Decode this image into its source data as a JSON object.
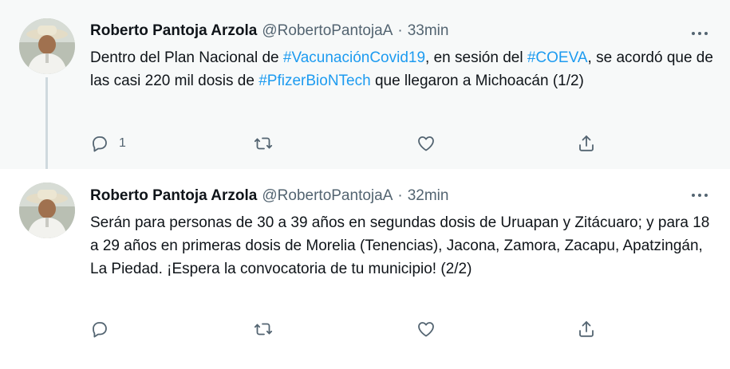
{
  "tweets": [
    {
      "name": "Roberto Pantoja Arzola",
      "handle": "@RobertoPantojaA",
      "dot": "·",
      "time": "33min",
      "text": [
        {
          "t": "Dentro del Plan Nacional de ",
          "tag": false
        },
        {
          "t": "#VacunaciónCovid19",
          "tag": true
        },
        {
          "t": ", en sesión del ",
          "tag": false
        },
        {
          "t": "#COEVA",
          "tag": true
        },
        {
          "t": ", se acordó que de las casi 220 mil dosis de ",
          "tag": false
        },
        {
          "t": "#PfizerBioNTech",
          "tag": true
        },
        {
          "t": " que llegaron a Michoacán (1/2)",
          "tag": false
        }
      ],
      "reply_count": "1"
    },
    {
      "name": "Roberto Pantoja Arzola",
      "handle": "@RobertoPantojaA",
      "dot": "·",
      "time": "32min",
      "text_plain": "Serán para personas de 30 a 39 años en segundas dosis de Uruapan y Zitácuaro; y para 18 a 29 años en primeras dosis de Morelia (Tenencias), Jacona, Zamora, Zacapu, Apatzingán, La Piedad. ¡Espera la convocatoria de tu municipio! (2/2)"
    }
  ],
  "icons": {
    "reply": "reply-icon",
    "retweet": "retweet-icon",
    "like": "like-icon",
    "share": "share-icon",
    "more": "more-icon"
  },
  "colors": {
    "link": "#1d9bf0",
    "secondary": "#536471",
    "thread_bg": "#f7f9f9"
  }
}
